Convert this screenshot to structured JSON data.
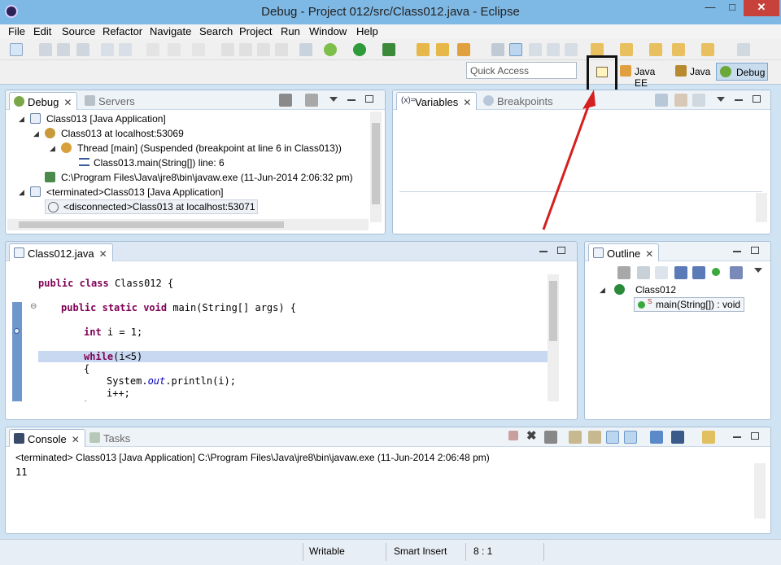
{
  "window": {
    "title": "Debug - Project 012/src/Class012.java - Eclipse",
    "min": "—",
    "max": "□",
    "close": "✕"
  },
  "menu": [
    "File",
    "Edit",
    "Source",
    "Refactor",
    "Navigate",
    "Search",
    "Project",
    "Run",
    "Window",
    "Help"
  ],
  "toolbar": {
    "quick_access_placeholder": "Quick Access",
    "open_perspective_icon": "open-perspective-icon",
    "perspectives": [
      {
        "label": "Java EE",
        "active": false
      },
      {
        "label": "Java",
        "active": false
      },
      {
        "label": "Debug",
        "active": true
      }
    ]
  },
  "debug_panel": {
    "tabs": [
      {
        "label": "Debug",
        "active": true
      },
      {
        "label": "Servers",
        "active": false
      }
    ],
    "tree": [
      {
        "text": "Class013 [Java Application]",
        "level": 0
      },
      {
        "text": "Class013 at localhost:53069",
        "level": 1
      },
      {
        "text": "Thread [main] (Suspended (breakpoint at line 6 in Class013))",
        "level": 2
      },
      {
        "text": "Class013.main(String[]) line: 6",
        "level": 3
      },
      {
        "text": "C:\\Program Files\\Java\\jre8\\bin\\javaw.exe (11-Jun-2014 2:06:32 pm)",
        "level": 1
      },
      {
        "text": "<terminated>Class013 [Java Application]",
        "level": 0
      },
      {
        "text": "<disconnected>Class013 at localhost:53071",
        "level": 1
      }
    ]
  },
  "variables_panel": {
    "tabs": [
      {
        "label": "Variables",
        "active": true
      },
      {
        "label": "Breakpoints",
        "active": false
      }
    ]
  },
  "editor": {
    "tab": "Class012.java",
    "lines": [
      "public class Class012 {",
      "    public static void main(String[] args) {",
      "        int i = 1;",
      "        while(i<5)",
      "        {",
      "            System.out.println(i);",
      "            i++;"
    ]
  },
  "outline": {
    "tab": "Outline",
    "class": "Class012",
    "method": "main(String[]) : void"
  },
  "console": {
    "tabs": [
      {
        "label": "Console",
        "active": true
      },
      {
        "label": "Tasks",
        "active": false
      }
    ],
    "header": "<terminated> Class013 [Java Application] C:\\Program Files\\Java\\jre8\\bin\\javaw.exe (11-Jun-2014 2:06:48 pm)",
    "output": "11"
  },
  "status": {
    "writable": "Writable",
    "insert_mode": "Smart Insert",
    "position": "8 : 1"
  },
  "colors": {
    "highlight_arrow": "#d61f1f",
    "current_line": "#c8d8f0",
    "keyword": "#7f0055"
  }
}
